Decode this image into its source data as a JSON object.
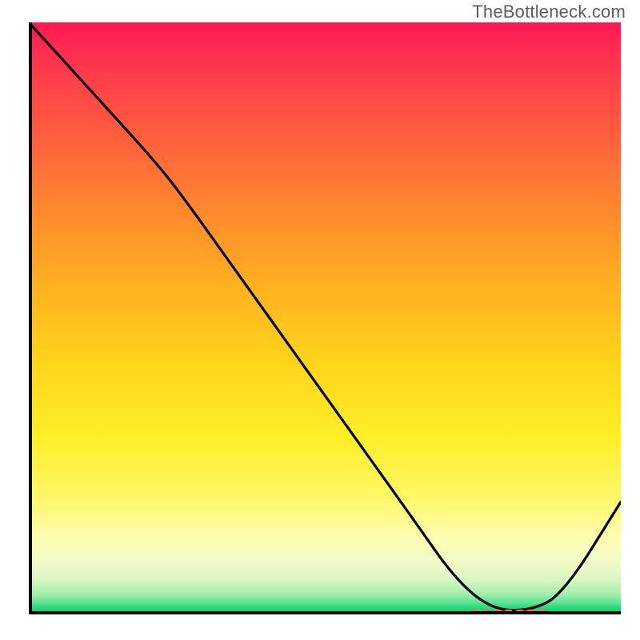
{
  "watermark": "TheBottleneck.com",
  "chart_data": {
    "type": "line",
    "title": "",
    "xlabel": "",
    "ylabel": "",
    "xlim": [
      0,
      100
    ],
    "ylim": [
      0,
      100
    ],
    "x": [
      0,
      10,
      20,
      25,
      35,
      45,
      55,
      65,
      72,
      78,
      84,
      90,
      100
    ],
    "values": [
      100,
      89,
      78,
      72,
      58,
      44,
      30,
      16,
      6,
      1,
      0.5,
      3,
      19
    ],
    "grid": false,
    "legend": false,
    "annotation": {
      "type": "dashed-segment",
      "x_start": 75,
      "x_end": 88,
      "y": 0.5,
      "color": "#ff6a4e"
    },
    "background_gradient_stops": [
      {
        "pct": 0,
        "color": "#ff1955"
      },
      {
        "pct": 8,
        "color": "#ff3a4c"
      },
      {
        "pct": 18,
        "color": "#ff5a40"
      },
      {
        "pct": 32,
        "color": "#ff892d"
      },
      {
        "pct": 45,
        "color": "#ffb220"
      },
      {
        "pct": 58,
        "color": "#ffd61c"
      },
      {
        "pct": 70,
        "color": "#ffee28"
      },
      {
        "pct": 80,
        "color": "#fff766"
      },
      {
        "pct": 87,
        "color": "#fffcb0"
      },
      {
        "pct": 91,
        "color": "#f5fbc8"
      },
      {
        "pct": 94,
        "color": "#d9f7c2"
      },
      {
        "pct": 96.5,
        "color": "#a6efad"
      },
      {
        "pct": 98,
        "color": "#5de493"
      },
      {
        "pct": 99,
        "color": "#1ed879"
      },
      {
        "pct": 100,
        "color": "#00ce6d"
      }
    ]
  }
}
